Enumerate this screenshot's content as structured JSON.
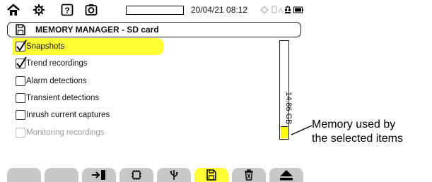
{
  "status_bar": {
    "icons": [
      "home-icon",
      "settings-icon",
      "help-icon",
      "screenshot-icon",
      "pin-icon",
      "network-icon",
      "battery-icon"
    ],
    "progress_fraction": 0,
    "datetime": "20/04/21 08:12"
  },
  "title_bar": {
    "icon": "sd-card-icon",
    "title": "MEMORY MANAGER - SD card"
  },
  "items": [
    {
      "label": "Snapshots",
      "checked": true,
      "highlighted": true,
      "enabled": true
    },
    {
      "label": "Trend recordings",
      "checked": true,
      "highlighted": false,
      "enabled": true
    },
    {
      "label": "Alarm detections",
      "checked": false,
      "highlighted": false,
      "enabled": true
    },
    {
      "label": "Transient detections",
      "checked": false,
      "highlighted": false,
      "enabled": true
    },
    {
      "label": "Inrush current captures",
      "checked": false,
      "highlighted": false,
      "enabled": true
    },
    {
      "label": "Monitoring recordings",
      "checked": false,
      "highlighted": false,
      "enabled": false
    }
  ],
  "memory": {
    "capacity_label": "14.86 GB",
    "used_fraction": 0.12,
    "used_color": "#ffff00"
  },
  "function_keys": [
    {
      "icon": "",
      "active": false
    },
    {
      "icon": "",
      "active": false
    },
    {
      "icon": "export-icon",
      "active": false
    },
    {
      "icon": "chip-icon",
      "active": false
    },
    {
      "icon": "usb-icon",
      "active": false
    },
    {
      "icon": "sd-card-icon",
      "active": true
    },
    {
      "icon": "trash-icon",
      "active": false
    },
    {
      "icon": "eject-icon",
      "active": false
    }
  ],
  "callout": {
    "line1": "Memory used by",
    "line2": "the selected items"
  },
  "colors": {
    "highlight": "#ffff33",
    "key_inactive": "#c8c8c8",
    "disabled_text": "#9a9a9a"
  }
}
